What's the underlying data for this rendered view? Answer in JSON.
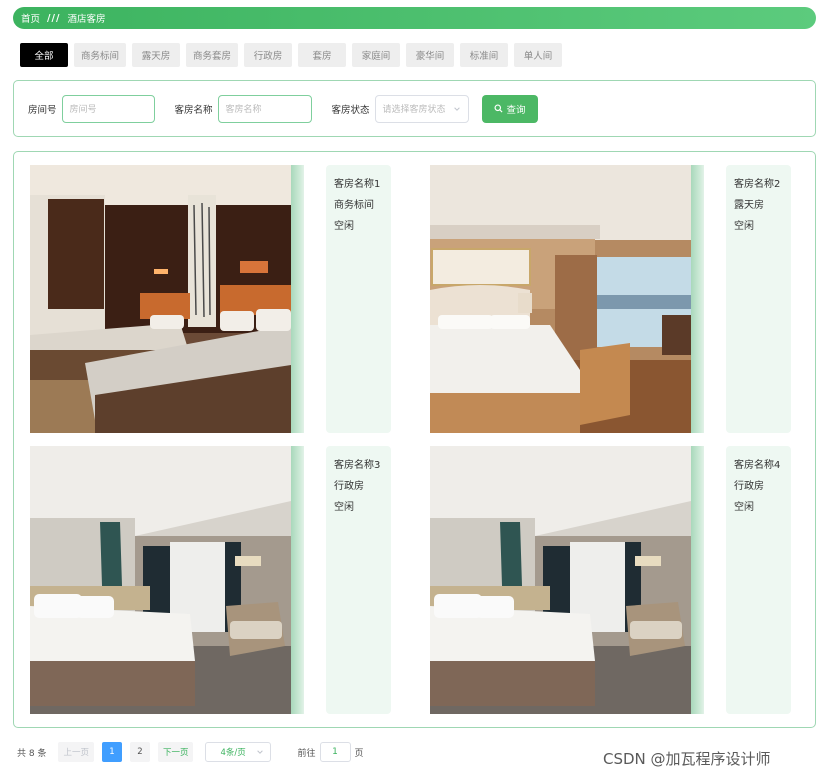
{
  "breadcrumb": {
    "home": "首页",
    "separator": "///",
    "current": "酒店客房"
  },
  "tabs": [
    {
      "label": "全部",
      "active": true
    },
    {
      "label": "商务标间"
    },
    {
      "label": "露天房"
    },
    {
      "label": "商务套房"
    },
    {
      "label": "行政房"
    },
    {
      "label": "套房"
    },
    {
      "label": "家庭间"
    },
    {
      "label": "豪华间"
    },
    {
      "label": "标准间"
    },
    {
      "label": "单人间"
    }
  ],
  "search": {
    "room_no_label": "房间号",
    "room_no_placeholder": "房间号",
    "room_name_label": "客房名称",
    "room_name_placeholder": "客房名称",
    "status_label": "客房状态",
    "status_placeholder": "请选择客房状态",
    "query_button": "查询"
  },
  "rooms": [
    {
      "name": "客房名称1",
      "type": "商务标间",
      "status": "空闲"
    },
    {
      "name": "客房名称2",
      "type": "露天房",
      "status": "空闲"
    },
    {
      "name": "客房名称3",
      "type": "行政房",
      "status": "空闲"
    },
    {
      "name": "客房名称4",
      "type": "行政房",
      "status": "空闲"
    }
  ],
  "pagination": {
    "total": "共 8 条",
    "prev": "上一页",
    "pages": [
      "1",
      "2"
    ],
    "current_page": "1",
    "next": "下一页",
    "page_size": "4条/页",
    "goto_prefix": "前往",
    "goto_value": "1",
    "goto_suffix": "页"
  },
  "watermark": "CSDN @加瓦程序设计师",
  "colors": {
    "accent": "#3cb35f",
    "border": "#9fd7b3",
    "active_page": "#409eff"
  }
}
